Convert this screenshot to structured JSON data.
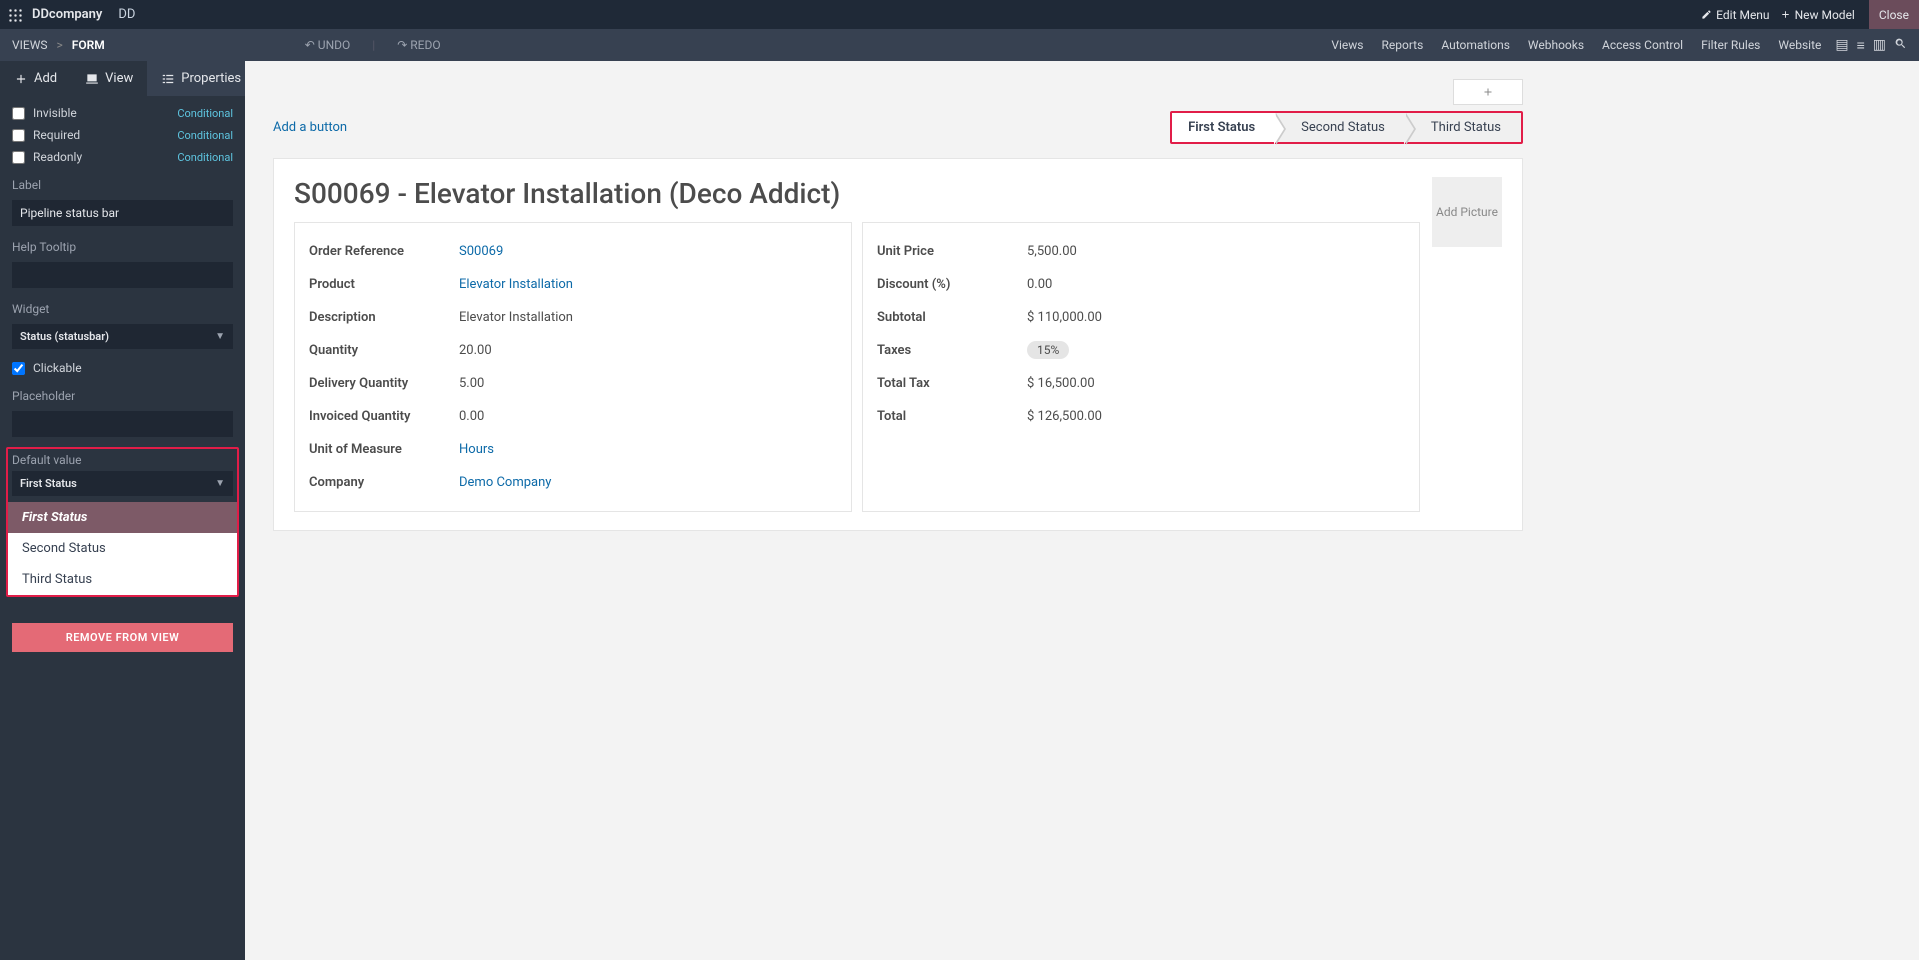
{
  "topbar": {
    "company": "DDcompany",
    "db": "DD",
    "edit_menu": "Edit Menu",
    "new_model": "New Model",
    "close": "Close"
  },
  "subbar": {
    "breadcrumb": {
      "views": "VIEWS",
      "current": "FORM"
    },
    "undo": "UNDO",
    "redo": "REDO",
    "tabs": [
      "Views",
      "Reports",
      "Automations",
      "Webhooks",
      "Access Control",
      "Filter Rules",
      "Website"
    ]
  },
  "side_tabs": {
    "add": "Add",
    "view": "View",
    "properties": "Properties"
  },
  "props": {
    "invisible": "Invisible",
    "required": "Required",
    "readonly": "Readonly",
    "conditional": "Conditional",
    "label_label": "Label",
    "label_value": "Pipeline status bar",
    "help_label": "Help Tooltip",
    "help_value": "",
    "widget_label": "Widget",
    "widget_value": "Status (statusbar)",
    "clickable": "Clickable",
    "placeholder_label": "Placeholder",
    "placeholder_value": "",
    "default_label": "Default value",
    "default_value": "First Status",
    "options": [
      "First Status",
      "Second Status",
      "Third Status"
    ],
    "remove": "REMOVE FROM VIEW"
  },
  "content": {
    "add_button": "Add a button",
    "statuses": [
      "First Status",
      "Second Status",
      "Third Status"
    ],
    "title": "S00069 - Elevator Installation (Deco Addict)",
    "add_picture": "Add Picture",
    "left_fields": [
      {
        "label": "Order Reference",
        "value": "S00069",
        "link": true
      },
      {
        "label": "Product",
        "value": "Elevator Installation",
        "link": true
      },
      {
        "label": "Description",
        "value": "Elevator Installation"
      },
      {
        "label": "Quantity",
        "value": "20.00"
      },
      {
        "label": "Delivery Quantity",
        "value": "5.00"
      },
      {
        "label": "Invoiced Quantity",
        "value": "0.00"
      },
      {
        "label": "Unit of Measure",
        "value": "Hours",
        "link": true
      },
      {
        "label": "Company",
        "value": "Demo Company",
        "link": true
      }
    ],
    "right_fields": [
      {
        "label": "Unit Price",
        "value": "5,500.00"
      },
      {
        "label": "Discount (%)",
        "value": "0.00"
      },
      {
        "label": "Subtotal",
        "value": "$ 110,000.00"
      },
      {
        "label": "Taxes",
        "value": "15%",
        "tag": true
      },
      {
        "label": "Total Tax",
        "value": "$ 16,500.00"
      },
      {
        "label": "Total",
        "value": "$ 126,500.00"
      }
    ]
  }
}
